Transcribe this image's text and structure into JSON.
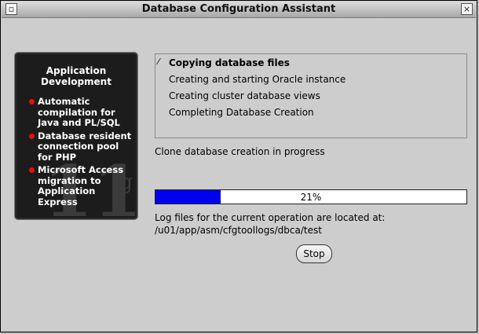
{
  "window": {
    "title": "Database Configuration Assistant",
    "menu_icon": "window-menu-icon",
    "close_icon": "close-icon"
  },
  "promo": {
    "title_line1": "Application",
    "title_line2": "Development",
    "items": [
      "Automatic compilation for Java and PL/SQL",
      "Database resident connection pool for PHP",
      "Microsoft Access migration to Application Express"
    ],
    "watermark": "11",
    "watermark_sup": "g",
    "bullet_color": "#e11111"
  },
  "steps": [
    {
      "label": "Copying database files",
      "state": "in-progress"
    },
    {
      "label": "Creating and starting Oracle instance",
      "state": "pending"
    },
    {
      "label": "Creating cluster database views",
      "state": "pending"
    },
    {
      "label": "Completing Database Creation",
      "state": "pending"
    }
  ],
  "status_text": "Clone database creation in progress",
  "progress": {
    "percent": 21,
    "label": "21%",
    "color": "#0000ee"
  },
  "log": {
    "label": "Log files for the current operation are located at:",
    "path": "/u01/app/asm/cfgtoollogs/dbca/test"
  },
  "buttons": {
    "stop": "Stop"
  }
}
